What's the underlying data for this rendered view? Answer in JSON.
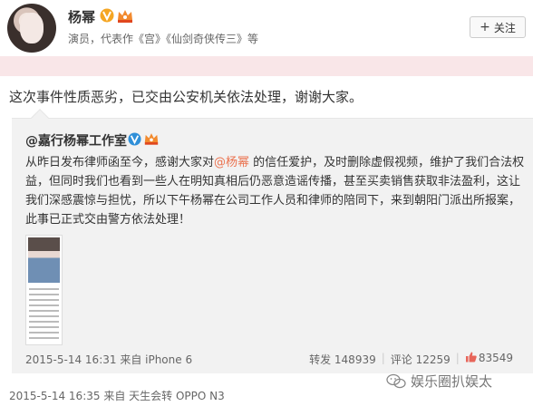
{
  "header": {
    "username": "杨幂",
    "description": "演员，代表作《宫》《仙剑奇侠传三》等",
    "follow_label": "关注",
    "follow_plus": "+"
  },
  "post": {
    "text": "这次事件性质恶劣，已交由公安机关依法处理，谢谢大家。",
    "meta": "2015-5-14 16:35 来自 天生会转 OPPO N3"
  },
  "repost": {
    "author": "@嘉行杨幂工作室",
    "body_before": "从昨日发布律师函至今，感谢大家对",
    "mention": "@杨幂",
    "body_after": " 的信任爱护，及时删除虚假视频，维护了我们合法权益，但同时我们也看到一些人在明知真相后仍恶意造谣传播，甚至买卖销售获取非法盈利，这让我们深感震惊与担忧，所以下午杨幂在公司工作人员和律师的陪同下，来到朝阳门派出所报案，此事已正式交由警方依法处理！",
    "meta": "2015-5-14 16:31 来自 iPhone 6",
    "repost_count": "转发 148939",
    "comment_count": "评论 12259",
    "like_count": "83549"
  },
  "watermark": {
    "text": "娱乐圈扒娱太"
  },
  "colors": {
    "mention": "#eb7350",
    "verified": "#f5a623",
    "pink_bar": "#f9e6e8"
  }
}
